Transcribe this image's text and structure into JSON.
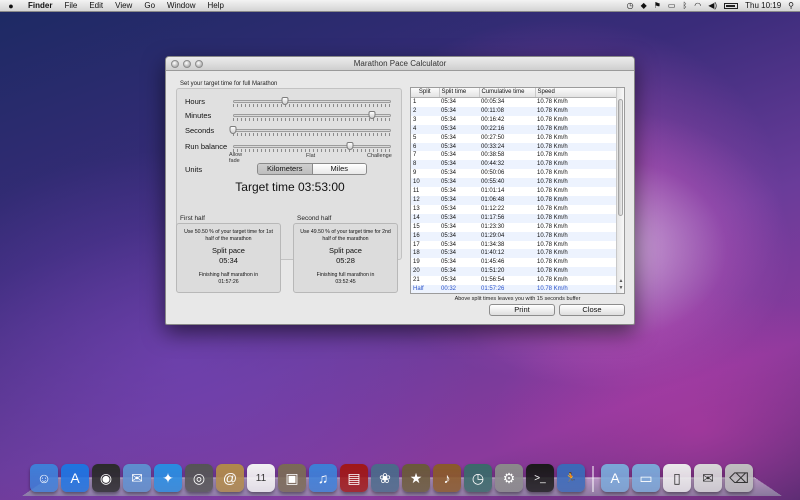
{
  "menubar": {
    "app": "Finder",
    "items": [
      "File",
      "Edit",
      "View",
      "Go",
      "Window",
      "Help"
    ],
    "clock": "Thu 10:19",
    "status_icons": [
      "apple-icon",
      "timemachine-icon",
      "dropbox-icon",
      "flag-icon",
      "screen-icon",
      "bluetooth-icon",
      "wifi-icon",
      "volume-icon",
      "battery-icon",
      "spotlight-icon"
    ]
  },
  "window": {
    "title": "Marathon Pace Calculator",
    "settings_title": "Set your target time for full Marathon",
    "labels": {
      "hours": "Hours",
      "minutes": "Minutes",
      "seconds": "Seconds",
      "run_balance": "Run balance",
      "units": "Units",
      "allow_fade": "Allow fade",
      "flat": "Flat",
      "challenge": "Challenge"
    },
    "slider_levels": {
      "hours": 0.33,
      "minutes": 0.88,
      "seconds": 0.0,
      "run_balance": 0.74
    },
    "units": {
      "kilometers": "Kilometers",
      "miles": "Miles",
      "selected": "Kilometers"
    },
    "target_time": "Target time 03:53:00",
    "first_half": {
      "title": "First half",
      "note": "Use 50.50 % of your target time for 1st half of the marathon",
      "split_label": "Split pace",
      "split_value": "05:34",
      "finish_note": "Finishing half marathon in",
      "finish_value": "01:57:26"
    },
    "second_half": {
      "title": "Second half",
      "note": "Use 49.50 % of your target time for 2nd half of the marathon",
      "split_label": "Split pace",
      "split_value": "05:28",
      "finish_note": "Finishing full marathon in",
      "finish_value": "03:52:45"
    },
    "table": {
      "headers": [
        "Split",
        "Split time",
        "Cumulative time",
        "Speed"
      ],
      "rows": [
        [
          "1",
          "05:34",
          "00:05:34",
          "10.78 Km/h"
        ],
        [
          "2",
          "05:34",
          "00:11:08",
          "10.78 Km/h"
        ],
        [
          "3",
          "05:34",
          "00:16:42",
          "10.78 Km/h"
        ],
        [
          "4",
          "05:34",
          "00:22:16",
          "10.78 Km/h"
        ],
        [
          "5",
          "05:34",
          "00:27:50",
          "10.78 Km/h"
        ],
        [
          "6",
          "05:34",
          "00:33:24",
          "10.78 Km/h"
        ],
        [
          "7",
          "05:34",
          "00:38:58",
          "10.78 Km/h"
        ],
        [
          "8",
          "05:34",
          "00:44:32",
          "10.78 Km/h"
        ],
        [
          "9",
          "05:34",
          "00:50:06",
          "10.78 Km/h"
        ],
        [
          "10",
          "05:34",
          "00:55:40",
          "10.78 Km/h"
        ],
        [
          "11",
          "05:34",
          "01:01:14",
          "10.78 Km/h"
        ],
        [
          "12",
          "05:34",
          "01:06:48",
          "10.78 Km/h"
        ],
        [
          "13",
          "05:34",
          "01:12:22",
          "10.78 Km/h"
        ],
        [
          "14",
          "05:34",
          "01:17:56",
          "10.78 Km/h"
        ],
        [
          "15",
          "05:34",
          "01:23:30",
          "10.78 Km/h"
        ],
        [
          "16",
          "05:34",
          "01:29:04",
          "10.78 Km/h"
        ],
        [
          "17",
          "05:34",
          "01:34:38",
          "10.78 Km/h"
        ],
        [
          "18",
          "05:34",
          "01:40:12",
          "10.78 Km/h"
        ],
        [
          "19",
          "05:34",
          "01:45:46",
          "10.78 Km/h"
        ],
        [
          "20",
          "05:34",
          "01:51:20",
          "10.78 Km/h"
        ],
        [
          "21",
          "05:34",
          "01:56:54",
          "10.78 Km/h"
        ],
        [
          "Half",
          "00:32",
          "01:57:26",
          "10.78 Km/h"
        ]
      ]
    },
    "buffer_note": "Above split times leaves you with 15 seconds buffer",
    "print_label": "Print",
    "close_label": "Close"
  },
  "dock": {
    "apps": [
      {
        "name": "finder",
        "bg": "#3f7fd8",
        "glyph": "☺"
      },
      {
        "name": "app-store",
        "bg": "#1f74e0",
        "glyph": "A"
      },
      {
        "name": "dashboard",
        "bg": "#2b2b2b",
        "glyph": "◉"
      },
      {
        "name": "mail",
        "bg": "#5e8fce",
        "glyph": "✉"
      },
      {
        "name": "safari",
        "bg": "#2a8de0",
        "glyph": "✦"
      },
      {
        "name": "facetime",
        "bg": "#555555",
        "glyph": "◎"
      },
      {
        "name": "address-book",
        "bg": "#b08a4a",
        "glyph": "@"
      },
      {
        "name": "ical",
        "bg": "#f2f2f2",
        "glyph": "11"
      },
      {
        "name": "preview",
        "bg": "#7a6a55",
        "glyph": "▣"
      },
      {
        "name": "itunes",
        "bg": "#3d7fd6",
        "glyph": "♫"
      },
      {
        "name": "photo-booth",
        "bg": "#a01818",
        "glyph": "▤"
      },
      {
        "name": "iphoto",
        "bg": "#4b6a8a",
        "glyph": "❀"
      },
      {
        "name": "imovie",
        "bg": "#6a5a3a",
        "glyph": "★"
      },
      {
        "name": "garageband",
        "bg": "#8a5a2a",
        "glyph": "♪"
      },
      {
        "name": "time-machine",
        "bg": "#3a6a6a",
        "glyph": "◷"
      },
      {
        "name": "system-preferences",
        "bg": "#8a8a8a",
        "glyph": "⚙"
      },
      {
        "name": "terminal",
        "bg": "#1a1a1a",
        "glyph": ">_"
      },
      {
        "name": "marathon-app",
        "bg": "#3a6ab8",
        "glyph": "🏃"
      }
    ],
    "stacks": [
      {
        "name": "applications-folder",
        "bg": "#7aa8d8",
        "glyph": "A"
      },
      {
        "name": "documents-folder",
        "bg": "#7aa8d8",
        "glyph": "▭"
      },
      {
        "name": "document",
        "bg": "#eaeaea",
        "glyph": "▯"
      },
      {
        "name": "downloads",
        "bg": "#d8d8d8",
        "glyph": "✉"
      },
      {
        "name": "trash",
        "bg": "#bfbfbf",
        "glyph": "⌫"
      }
    ]
  }
}
